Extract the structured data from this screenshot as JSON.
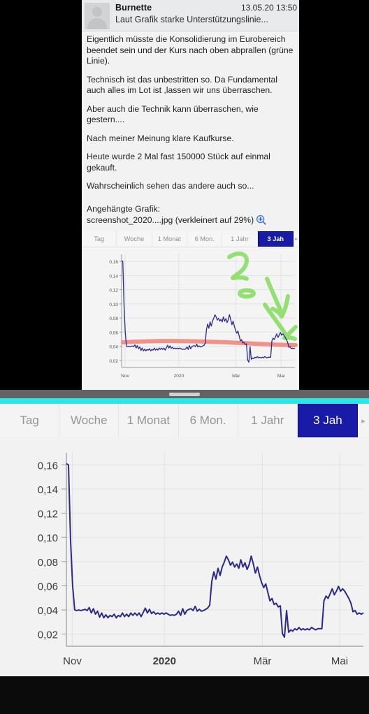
{
  "post": {
    "author": "Burnette",
    "timestamp": "13.05.20 13:50",
    "subject": "Laut Grafik starke Unterstützungslinie...",
    "paragraphs": [
      "Eigentlich müsste die Konsolidierung im Eurobereich beendet sein und der Kurs nach oben abprallen (grüne Linie).",
      "Technisch ist das unbestritten so. Da Fundamental auch alles im Lot ist ,lassen wir uns überraschen.",
      "Aber auch die Technik kann überraschen, wie gestern....",
      "Nach meiner Meinung klare Kaufkurse.",
      "Heute wurde 2 Mal fast 150000 Stück auf einmal gekauft.",
      "Wahrscheinlich sehen das andere auch so..."
    ],
    "attachment_label": "Angehängte Grafik:",
    "attachment_file": "screenshot_2020....jpg (verkleinert auf 29%)",
    "zoom_icon": "magnifier-plus-icon"
  },
  "mini_tabs": {
    "items": [
      "Tag",
      "Woche",
      "1 Monat",
      "6 Mon.",
      "1 Jahr",
      "3 Jah"
    ],
    "selected_index": 5,
    "overflow_arrow": "▸"
  },
  "main_tabs": {
    "items": [
      "Tag",
      "Woche",
      "1 Monat",
      "6 Mon.",
      "1 Jahr",
      "3 Jah"
    ],
    "selected_index": 5,
    "overflow_arrow": "▸"
  },
  "colors": {
    "accent_bar": "#2ee5e5",
    "selected_tab": "#1a1aa8",
    "price_line": "#2a2a8c",
    "support_line": "#f0887e",
    "annotation_green": "#8ede6a",
    "panel_bg": "#f2f2f2",
    "chart_bg": "#f2f2f2",
    "grid": "#e0e0e0"
  },
  "chart_data": [
    {
      "id": "main-chart",
      "type": "line",
      "title": "",
      "xlabel": "",
      "ylabel": "",
      "ylim": [
        0.01,
        0.17
      ],
      "y_ticks": [
        0.16,
        0.14,
        0.12,
        0.1,
        0.08,
        0.06,
        0.04,
        0.02
      ],
      "y_tick_labels": [
        "0,16",
        "0,14",
        "0,12",
        "0,10",
        "0,08",
        "0,06",
        "0,04",
        "0,02"
      ],
      "x_tick_labels": [
        "Nov",
        "2020",
        "Mär",
        "Mai"
      ],
      "x_tick_positions": [
        0.02,
        0.33,
        0.66,
        0.92
      ],
      "x_tick_bold": [
        false,
        true,
        false,
        false
      ],
      "grid": true,
      "legend": "none",
      "series": [
        {
          "name": "Kurs",
          "color": "#2a2a8c",
          "values": [
            0.161,
            0.16,
            0.098,
            0.06,
            0.04,
            0.0395,
            0.04,
            0.0395,
            0.04,
            0.0405,
            0.0395,
            0.042,
            0.0375,
            0.041,
            0.0365,
            0.039,
            0.034,
            0.0375,
            0.0335,
            0.036,
            0.0335,
            0.0355,
            0.0345,
            0.0365,
            0.0335,
            0.0355,
            0.0345,
            0.0375,
            0.0345,
            0.0365,
            0.0345,
            0.0375,
            0.0355,
            0.0375,
            0.0355,
            0.0375,
            0.0345,
            0.038,
            0.0415,
            0.0375,
            0.0405,
            0.037,
            0.0385,
            0.0365,
            0.0375,
            0.0365,
            0.0375,
            0.0365,
            0.0375,
            0.0365,
            0.0355,
            0.036,
            0.0355,
            0.0365,
            0.039,
            0.0355,
            0.041,
            0.0365,
            0.0395,
            0.0405,
            0.041,
            0.0395,
            0.043,
            0.039,
            0.0405,
            0.039,
            0.0395,
            0.0405,
            0.0415,
            0.044,
            0.0635,
            0.0715,
            0.0655,
            0.0745,
            0.0685,
            0.0755,
            0.0795,
            0.0845,
            0.0815,
            0.077,
            0.0795,
            0.0755,
            0.078,
            0.0745,
            0.0815,
            0.0755,
            0.079,
            0.0735,
            0.0775,
            0.0845,
            0.078,
            0.0705,
            0.0755,
            0.0685,
            0.0625,
            0.0585,
            0.0615,
            0.0545,
            0.0475,
            0.0495,
            0.0445,
            0.0455,
            0.0425,
            0.0435,
            0.0205,
            0.0175,
            0.0395,
            0.0215,
            0.0235,
            0.0225,
            0.0245,
            0.0235,
            0.0255,
            0.0235,
            0.0245,
            0.0235,
            0.0245,
            0.0235,
            0.0255,
            0.0245,
            0.0235,
            0.0245,
            0.0245,
            0.0245,
            0.0475,
            0.0515,
            0.0495,
            0.0535,
            0.0575,
            0.0525,
            0.0555,
            0.0595,
            0.0555,
            0.0575,
            0.0555,
            0.0525,
            0.0495,
            0.0455,
            0.0385,
            0.0395,
            0.0365,
            0.0375,
            0.0365,
            0.0375
          ]
        }
      ]
    },
    {
      "id": "mini-chart",
      "type": "line",
      "title": "",
      "ylim": [
        0.01,
        0.17
      ],
      "y_ticks": [
        0.16,
        0.14,
        0.12,
        0.1,
        0.08,
        0.06,
        0.04,
        0.02
      ],
      "y_tick_labels": [
        "0,16",
        "0,14",
        "0,12",
        "0,10",
        "0,08",
        "0,06",
        "0,04",
        "0,02"
      ],
      "x_tick_labels": [
        "Nov",
        "2020",
        "Mär",
        "Mai"
      ],
      "x_tick_positions": [
        0.02,
        0.33,
        0.66,
        0.92
      ],
      "grid": true,
      "annotations": [
        {
          "type": "support-line",
          "color": "#f0887e",
          "label": "rote Unterstützungslinie"
        },
        {
          "type": "hand-drawn-arrow",
          "color": "#8ede6a",
          "label": "grüne Linie"
        },
        {
          "type": "hand-drawn-arrow",
          "color": "#8ede6a",
          "label": "grüne Linie"
        },
        {
          "type": "hand-drawn-ellipse",
          "color": "#8ede6a",
          "label": "grüne Markierung"
        }
      ],
      "series": [
        {
          "name": "Kurs",
          "color": "#2a2a8c",
          "values": [
            0.161,
            0.16,
            0.098,
            0.06,
            0.04,
            0.0395,
            0.04,
            0.0395,
            0.04,
            0.0405,
            0.0395,
            0.042,
            0.0375,
            0.041,
            0.0365,
            0.039,
            0.034,
            0.0375,
            0.0335,
            0.036,
            0.0335,
            0.0355,
            0.0345,
            0.0365,
            0.0335,
            0.0355,
            0.0345,
            0.0375,
            0.0345,
            0.0365,
            0.0345,
            0.0375,
            0.0355,
            0.0375,
            0.0355,
            0.0375,
            0.0345,
            0.038,
            0.0415,
            0.0375,
            0.0405,
            0.037,
            0.0385,
            0.0365,
            0.0375,
            0.0365,
            0.0375,
            0.0365,
            0.0375,
            0.0365,
            0.0355,
            0.036,
            0.0355,
            0.0365,
            0.039,
            0.0355,
            0.041,
            0.0365,
            0.0395,
            0.0405,
            0.041,
            0.0395,
            0.043,
            0.039,
            0.0405,
            0.039,
            0.0395,
            0.0405,
            0.0415,
            0.044,
            0.0635,
            0.0715,
            0.0655,
            0.0745,
            0.0685,
            0.0755,
            0.0795,
            0.0845,
            0.0815,
            0.077,
            0.0795,
            0.0755,
            0.078,
            0.0745,
            0.0815,
            0.0755,
            0.079,
            0.0735,
            0.0775,
            0.0845,
            0.078,
            0.0705,
            0.0755,
            0.0685,
            0.0625,
            0.0585,
            0.0615,
            0.0545,
            0.0475,
            0.0495,
            0.0445,
            0.0455,
            0.0425,
            0.0435,
            0.0205,
            0.0175,
            0.0395,
            0.0215,
            0.0235,
            0.0225,
            0.0245,
            0.0235,
            0.0255,
            0.0235,
            0.0245,
            0.0235,
            0.0245,
            0.0235,
            0.0255,
            0.0245,
            0.0235,
            0.0245,
            0.0245,
            0.0245,
            0.0475,
            0.0515,
            0.0495,
            0.0535,
            0.0575,
            0.0525,
            0.0555,
            0.0595,
            0.0555,
            0.0575,
            0.0555,
            0.0525,
            0.0495,
            0.0455,
            0.0385,
            0.0395,
            0.0365,
            0.0375,
            0.0365,
            0.0375
          ]
        }
      ]
    }
  ]
}
